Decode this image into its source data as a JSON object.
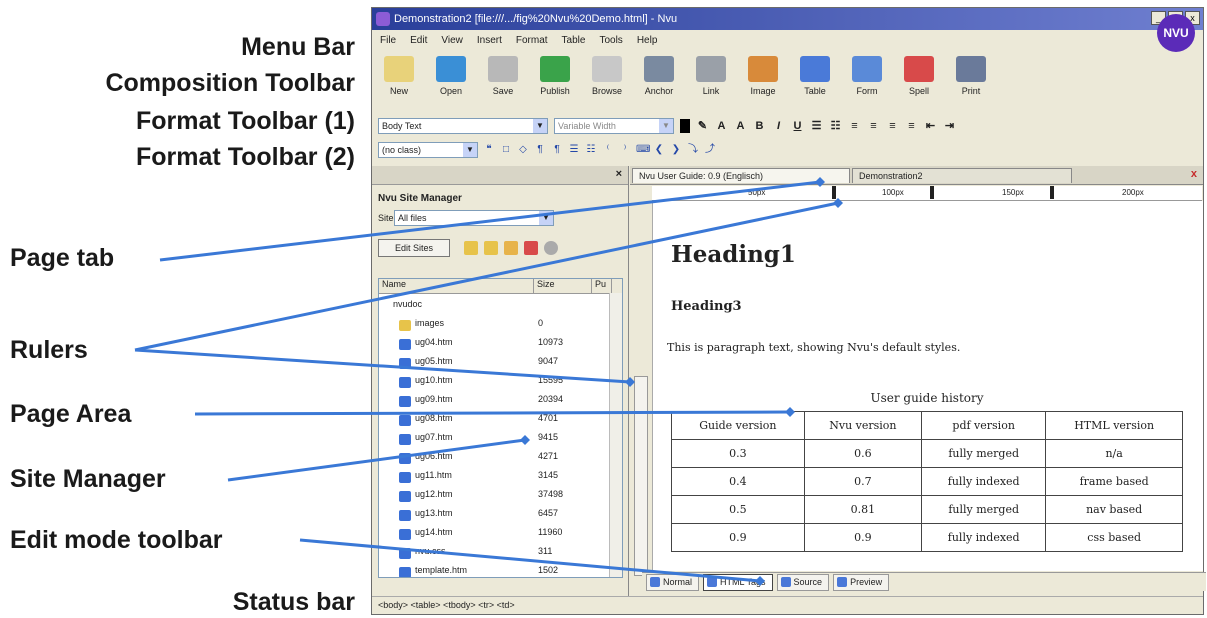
{
  "callouts": {
    "menu_bar": "Menu Bar",
    "composition_toolbar": "Composition Toolbar",
    "format_toolbar_1": "Format Toolbar (1)",
    "format_toolbar_2": "Format Toolbar (2)",
    "page_tab": "Page tab",
    "rulers": "Rulers",
    "page_area": "Page Area",
    "site_manager": "Site Manager",
    "edit_mode_toolbar": "Edit mode toolbar",
    "status_bar": "Status bar",
    "line_color": "#3a78d6"
  },
  "window": {
    "title": "Demonstration2 [file:///.../fig%20Nvu%20Demo.html] - Nvu",
    "minimize": "_",
    "maximize": "□",
    "close": "x"
  },
  "menu": [
    "File",
    "Edit",
    "View",
    "Insert",
    "Format",
    "Table",
    "Tools",
    "Help"
  ],
  "composition_toolbar": {
    "buttons": [
      {
        "label": "New",
        "icon": "new-page-icon",
        "color": "#e8d27a"
      },
      {
        "label": "Open",
        "icon": "open-folder-icon",
        "color": "#3a8fd6"
      },
      {
        "label": "Save",
        "icon": "save-disk-icon",
        "color": "#b8b8b8"
      },
      {
        "label": "Publish",
        "icon": "publish-globe-icon",
        "color": "#3aa34a"
      },
      {
        "label": "Browse",
        "icon": "browse-magnifier-icon",
        "color": "#c8c8c8"
      },
      {
        "label": "Anchor",
        "icon": "anchor-icon",
        "color": "#7a8aa0"
      },
      {
        "label": "Link",
        "icon": "link-chain-icon",
        "color": "#9aa0a8"
      },
      {
        "label": "Image",
        "icon": "image-icon",
        "color": "#d88a3a"
      },
      {
        "label": "Table",
        "icon": "table-icon",
        "color": "#4a7ad8"
      },
      {
        "label": "Form",
        "icon": "form-icon",
        "color": "#5a8ad8"
      },
      {
        "label": "Spell",
        "icon": "spell-check-icon",
        "color": "#d84a4a"
      },
      {
        "label": "Print",
        "icon": "printer-icon",
        "color": "#6a7a9a"
      }
    ],
    "logo": "NVU"
  },
  "format_toolbar_1": {
    "paragraph_style": "Body Text",
    "font": "Variable Width",
    "buttons": [
      "B",
      "I",
      "U"
    ]
  },
  "format_toolbar_2": {
    "class_select": "(no class)"
  },
  "site_manager": {
    "close": "×",
    "title": "Nvu Site Manager",
    "site_label": "Site:",
    "site_value": "All files",
    "edit_sites": "Edit Sites",
    "columns": [
      "Name",
      "Size",
      "Pu"
    ],
    "root": "nvudoc",
    "files": [
      {
        "name": "images",
        "size": "0",
        "folder": true
      },
      {
        "name": "ug04.htm",
        "size": "10973"
      },
      {
        "name": "ug05.htm",
        "size": "9047"
      },
      {
        "name": "ug10.htm",
        "size": "15595"
      },
      {
        "name": "ug09.htm",
        "size": "20394"
      },
      {
        "name": "ug08.htm",
        "size": "4701"
      },
      {
        "name": "ug07.htm",
        "size": "9415"
      },
      {
        "name": "ug06.htm",
        "size": "4271"
      },
      {
        "name": "ug11.htm",
        "size": "3145"
      },
      {
        "name": "ug12.htm",
        "size": "37498"
      },
      {
        "name": "ug13.htm",
        "size": "6457"
      },
      {
        "name": "ug14.htm",
        "size": "11960"
      },
      {
        "name": "nvu.css",
        "size": "311"
      },
      {
        "name": "template.htm",
        "size": "1502"
      }
    ]
  },
  "page_tabs": {
    "tab1": "Nvu User Guide: 0.9 (Englisch)",
    "tab2": "Demonstration2",
    "close": "x"
  },
  "ruler": {
    "ticks": [
      "50px",
      "100px",
      "150px",
      "200px"
    ]
  },
  "page": {
    "heading1": "Heading1",
    "heading3": "Heading3",
    "body": "This is paragraph text, showing Nvu's default styles.",
    "table_caption": "User guide history",
    "table_headers": [
      "Guide version",
      "Nvu version",
      "pdf version",
      "HTML version"
    ],
    "table_rows": [
      [
        "0.3",
        "0.6",
        "fully merged",
        "n/a"
      ],
      [
        "0.4",
        "0.7",
        "fully indexed",
        "frame based"
      ],
      [
        "0.5",
        "0.81",
        "fully merged",
        "nav based"
      ],
      [
        "0.9",
        "0.9",
        "fully indexed",
        "css based"
      ]
    ]
  },
  "edit_mode": [
    "Normal",
    "HTML Tags",
    "Source",
    "Preview"
  ],
  "status_bar": "<body> <table> <tbody> <tr> <td>"
}
